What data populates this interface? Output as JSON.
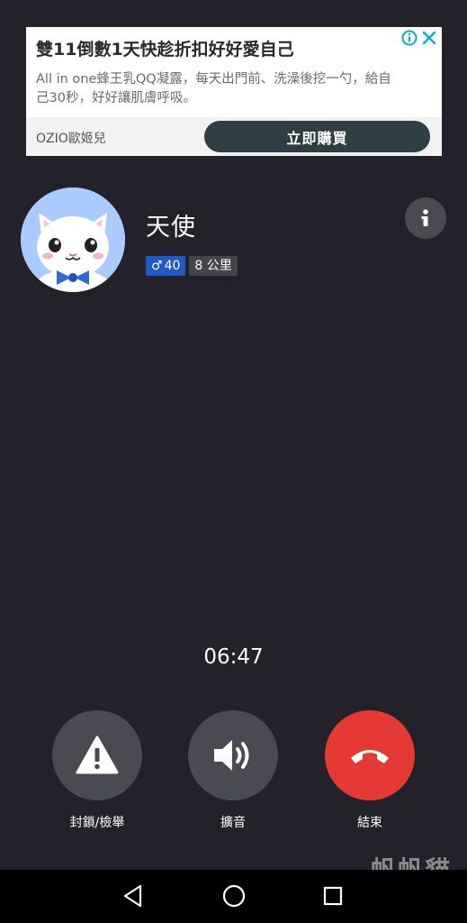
{
  "ad": {
    "title": "雙11倒數1天快趁折扣好好愛自己",
    "body": "All in one蜂王乳QQ凝露，每天出門前、洗澡後挖一勺，給自己30秒，好好讓肌膚呼吸。",
    "brand": "OZIO歐姬兒",
    "cta": "立即購買"
  },
  "caller": {
    "name": "天使",
    "gender_symbol": "♂",
    "age": "40",
    "distance": "8 公里"
  },
  "call": {
    "duration": "06:47"
  },
  "actions": [
    {
      "label": "封鎖/檢舉",
      "icon": "warning-icon"
    },
    {
      "label": "擴音",
      "icon": "speaker-icon"
    },
    {
      "label": "結束",
      "icon": "hangup-icon"
    }
  ],
  "colors": {
    "background": "#23222b",
    "action_button": "#4a4a52",
    "end_call": "#e53935",
    "age_badge": "#2159c4",
    "cta": "#2f3e45"
  },
  "watermark": "帆帆貓",
  "navbar": {
    "icons": [
      "back-icon",
      "home-icon",
      "recents-icon"
    ]
  }
}
